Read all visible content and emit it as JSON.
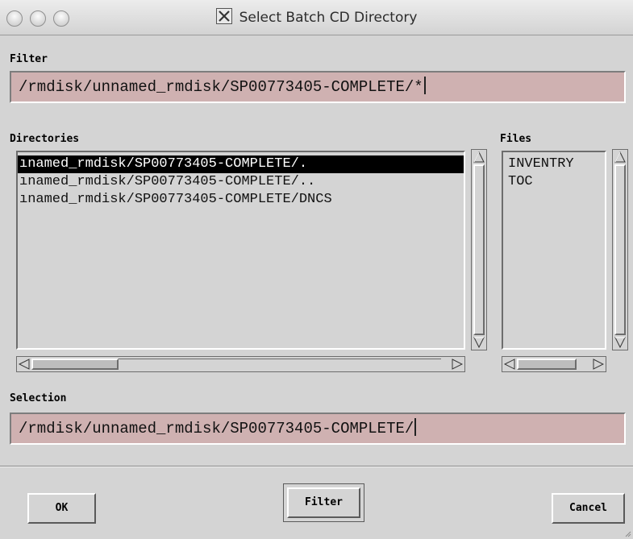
{
  "window": {
    "title": "Select Batch CD Directory"
  },
  "filter": {
    "label": "Filter",
    "value": "/rmdisk/unnamed_rmdisk/SP00773405-COMPLETE/*"
  },
  "directories": {
    "label": "Directories",
    "items": [
      "ınamed_rmdisk/SP00773405-COMPLETE/.",
      "ınamed_rmdisk/SP00773405-COMPLETE/..",
      "ınamed_rmdisk/SP00773405-COMPLETE/DNCS"
    ],
    "selected_index": 0
  },
  "files": {
    "label": "Files",
    "items": [
      "INVENTRY",
      "TOC"
    ]
  },
  "selection": {
    "label": "Selection",
    "value": "/rmdisk/unnamed_rmdisk/SP00773405-COMPLETE/"
  },
  "buttons": {
    "ok": "OK",
    "filter": "Filter",
    "cancel": "Cancel"
  },
  "icons": {
    "window_icon": "x11-icon",
    "close": "close-icon",
    "minimize": "minimize-icon",
    "zoom": "zoom-icon"
  }
}
